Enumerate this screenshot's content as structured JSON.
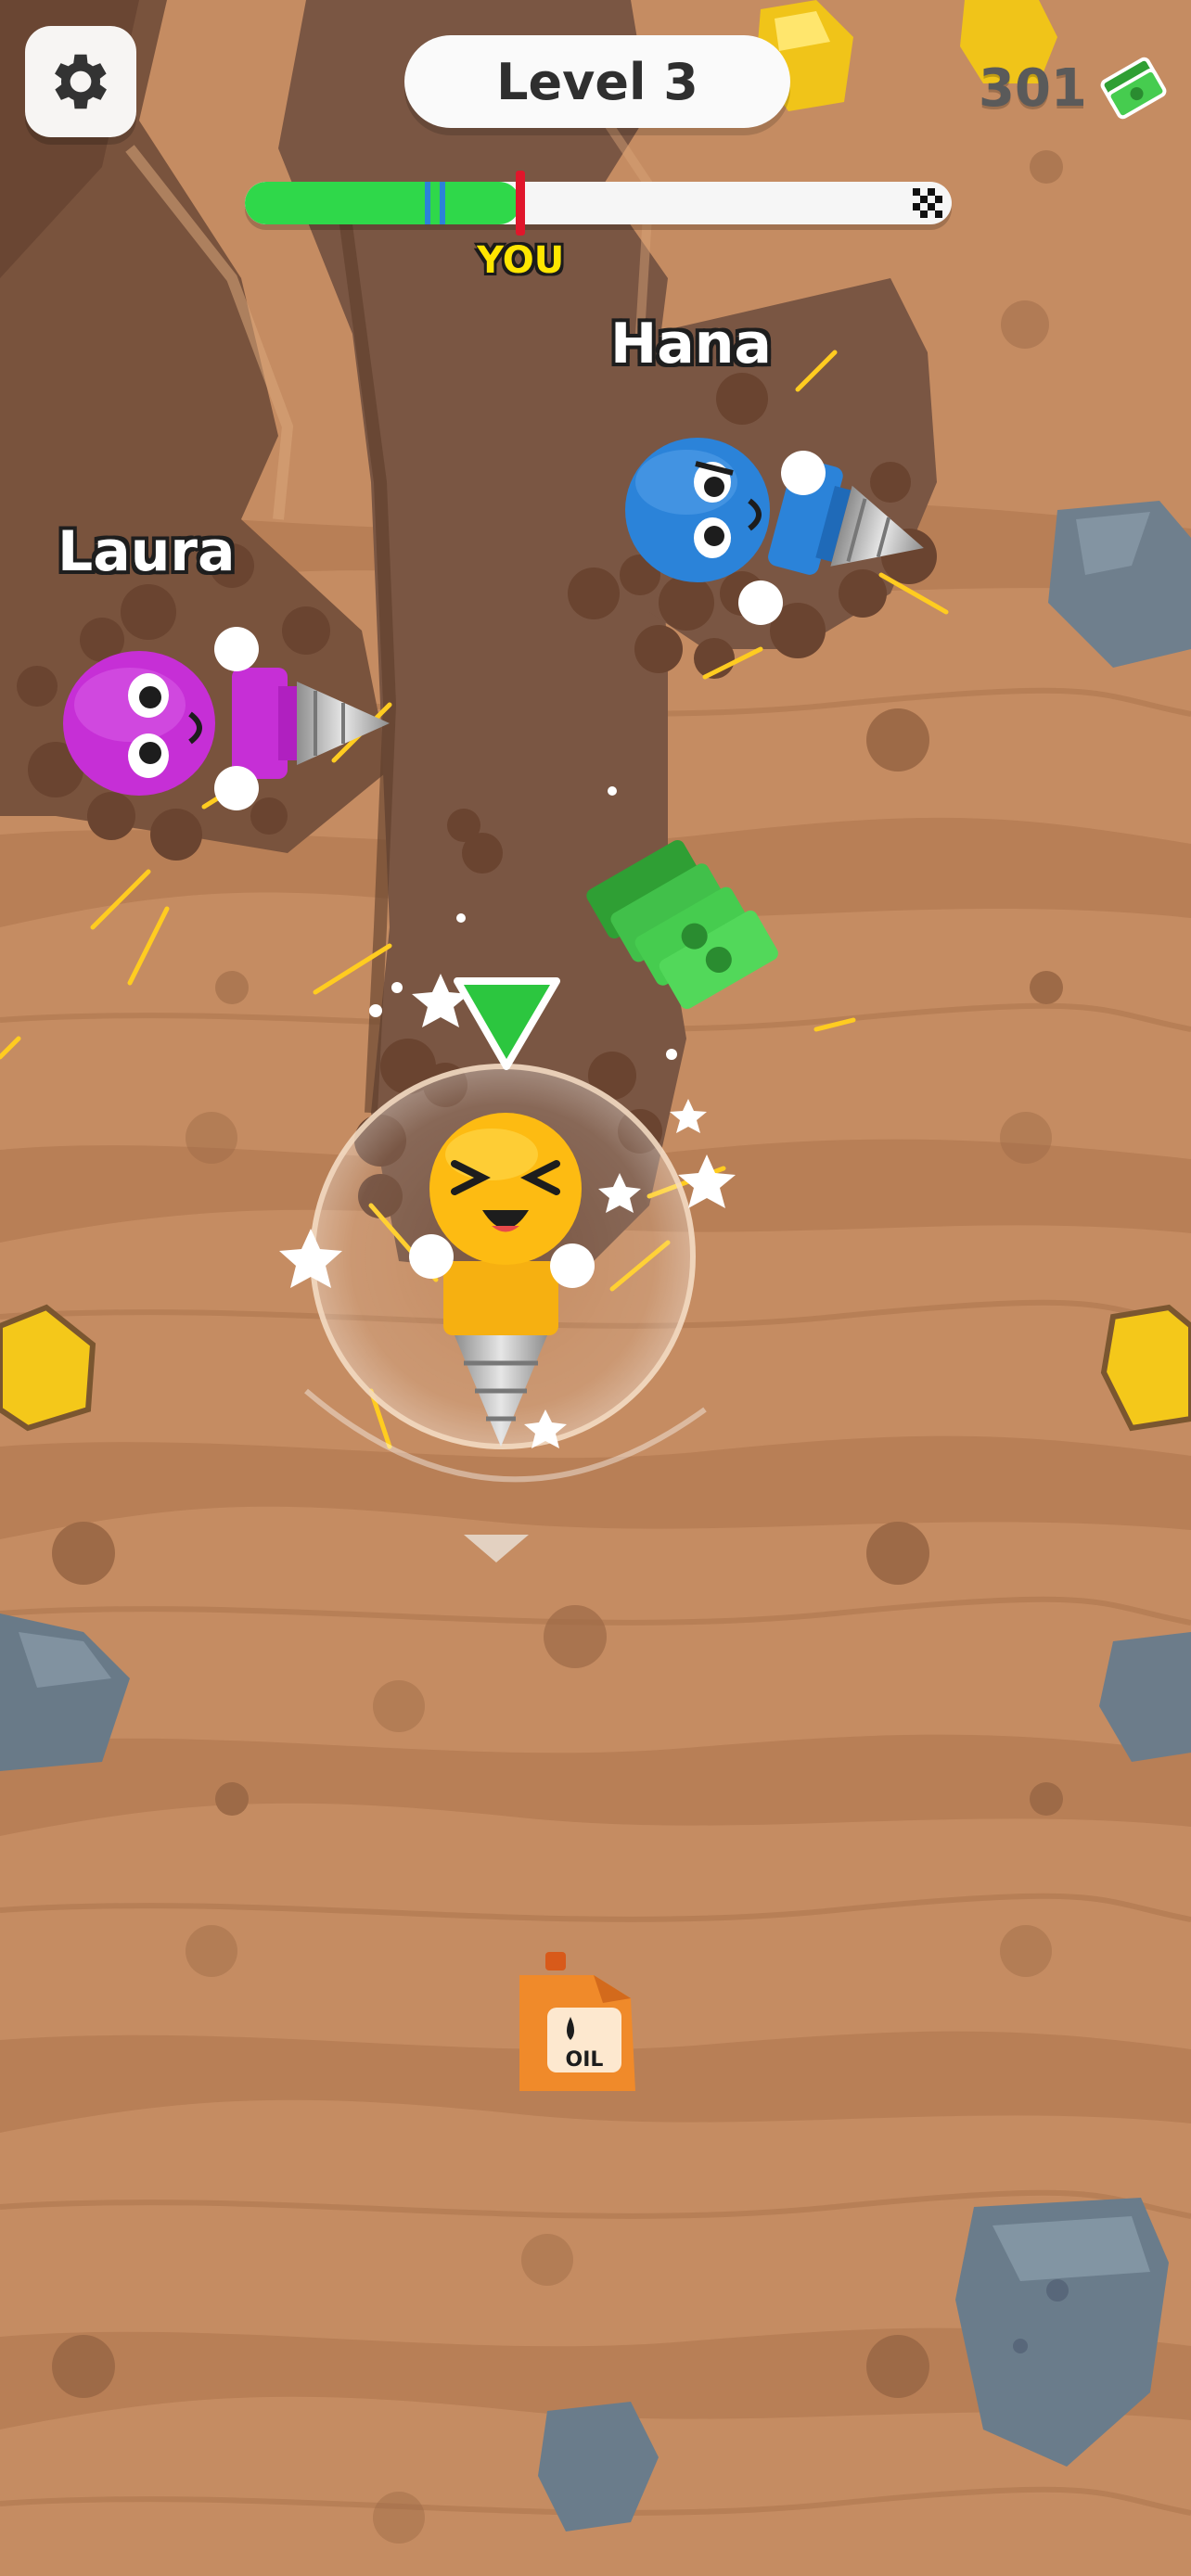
{
  "hud": {
    "level_label": "Level 3",
    "money": "301",
    "you_label": "YOU",
    "progress": {
      "player_fraction": 0.39,
      "opponent_markers": [
        {
          "fraction": 0.255,
          "color": "#2b83d9"
        },
        {
          "fraction": 0.275,
          "color": "#2b83d9"
        }
      ],
      "fill_color": "#2fd84a",
      "finish_icon": "checkered-flag-icon"
    },
    "settings_icon": "gear-icon",
    "money_icon": "cash-stack-icon"
  },
  "players": [
    {
      "name": "Hana",
      "color": "#2b83d9"
    },
    {
      "name": "Laura",
      "color": "#c62fd6"
    }
  ],
  "pickups": {
    "oil_label": "OIL"
  },
  "colors": {
    "dirt_light": "#c98f63",
    "dirt_dark": "#b57a52",
    "tunnel": "#7b5845",
    "rock": "#6e7e8c",
    "gold": "#f5cc1c",
    "player": "#fdbb12"
  }
}
